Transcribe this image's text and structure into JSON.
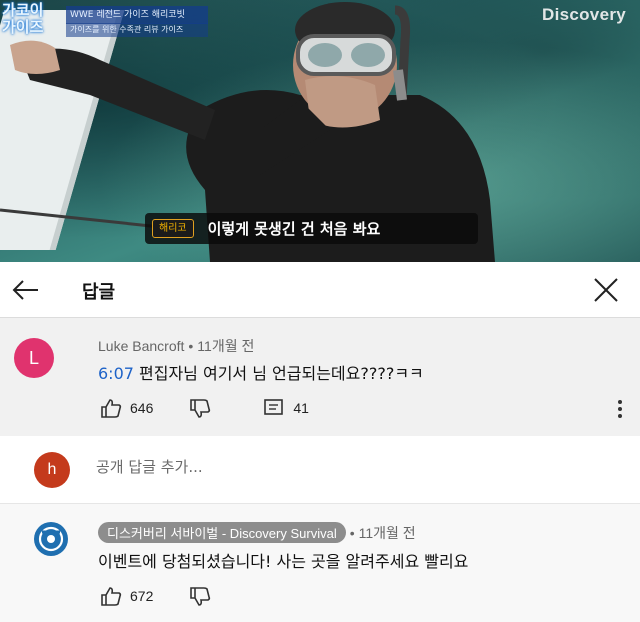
{
  "video": {
    "show_logo": "가코이\n가이즈",
    "show_sub_line1": "WWE 레전드 가이즈 해리코빗",
    "show_sub_line2": "가이즈를 위한 수족관 리뷰 가이즈",
    "brand": "Discovery",
    "caption_tag": "해리코",
    "caption_text": "이렇게 못생긴 건 처음 봐요"
  },
  "header": {
    "title": "답글",
    "back_icon": "arrow-left-icon",
    "close_icon": "close-icon"
  },
  "parent_comment": {
    "avatar_letter": "L",
    "avatar_color": "#e0336e",
    "author": "Luke Bancroft",
    "age": "11개월 전",
    "timestamp": "6:07",
    "text": " 편집자님 여기서 님 언급되는데요????ㅋㅋ",
    "likes": "646",
    "replies": "41"
  },
  "add_reply": {
    "avatar_letter": "h",
    "avatar_color": "#c43a1c",
    "placeholder": "공개 답글 추가..."
  },
  "reply_comment": {
    "avatar_color": "#1f6fb0",
    "author": "디스커버리 서바이벌 - Discovery Survival",
    "age": "11개월 전",
    "text": "이벤트에 당첨되셨습니다! 사는 곳을 알려주세요 빨리요",
    "likes": "672"
  },
  "colors": {
    "link": "#1d62c8",
    "chip": "#8d8d8d"
  }
}
